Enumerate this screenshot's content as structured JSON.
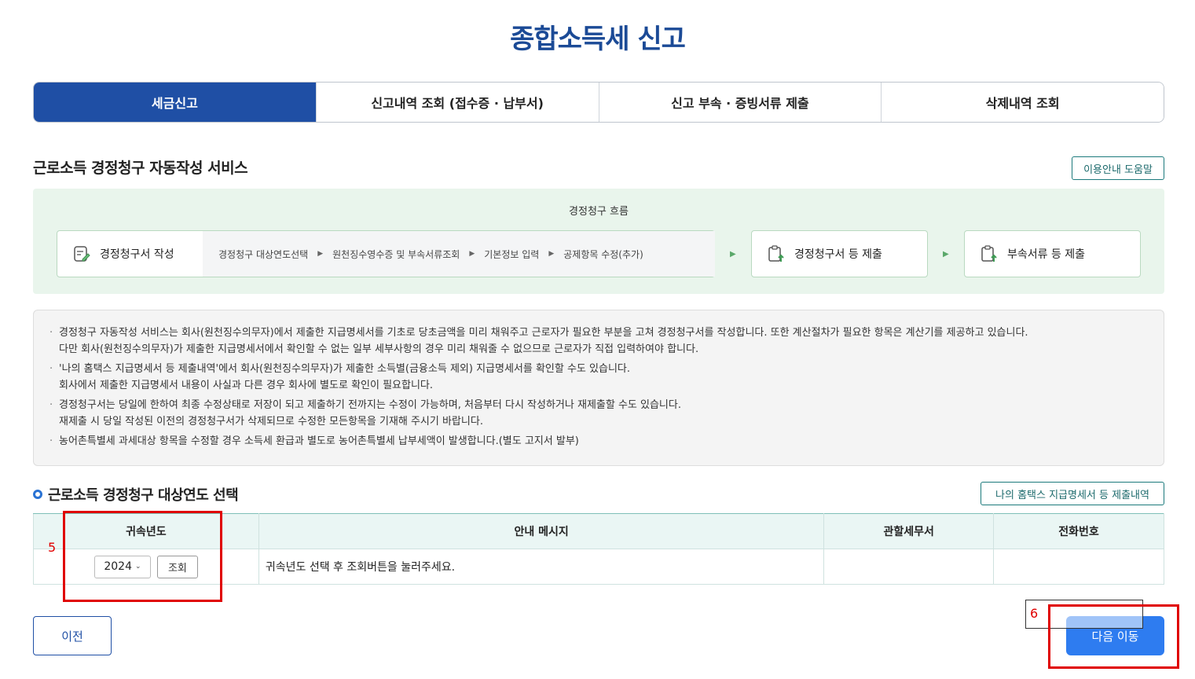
{
  "page": {
    "title": "종합소득세 신고"
  },
  "tabs": [
    {
      "label": "세금신고",
      "active": true
    },
    {
      "label": "신고내역 조회 (접수증 · 납부서)",
      "active": false
    },
    {
      "label": "신고 부속 · 증빙서류 제출",
      "active": false
    },
    {
      "label": "삭제내역 조회",
      "active": false
    }
  ],
  "service": {
    "title": "근로소득 경정청구 자동작성 서비스",
    "help_button": "이용안내 도움말"
  },
  "flow": {
    "title": "경정청구 흐름",
    "step1": {
      "label": "경정청구서 작성",
      "icon": "document-edit-icon"
    },
    "substeps": [
      "경정청구 대상연도선택",
      "원천징수영수증 및 부속서류조회",
      "기본정보 입력",
      "공제항목 수정(추가)"
    ],
    "step2": {
      "label": "경정청구서 등 제출",
      "icon": "document-upload-icon"
    },
    "step3": {
      "label": "부속서류 등 제출",
      "icon": "document-upload-icon"
    }
  },
  "notice": {
    "items": [
      [
        "경정청구 자동작성 서비스는 회사(원천징수의무자)에서 제출한 지급명세서를 기초로 당초금액을 미리 채워주고 근로자가 필요한 부분을 고쳐 경정청구서를 작성합니다. 또한 계산절차가 필요한 항목은 계산기를 제공하고 있습니다.",
        "다만 회사(원천징수의무자)가 제출한 지급명세서에서 확인할 수 없는 일부 세부사항의 경우 미리 채워줄 수 없으므로 근로자가 직접 입력하여야 합니다."
      ],
      [
        "'나의 홈택스 지급명세서 등 제출내역'에서 회사(원천징수의무자)가 제출한 소득별(금융소득 제외) 지급명세서를 확인할 수도 있습니다.",
        "회사에서 제출한 지급명세서 내용이 사실과 다른 경우 회사에 별도로 확인이 필요합니다."
      ],
      [
        "경정청구서는 당일에 한하여 최종 수정상태로 저장이 되고 제출하기 전까지는 수정이 가능하며, 처음부터 다시 작성하거나 재제출할 수도 있습니다.",
        "재제출 시 당일 작성된 이전의 경정청구서가 삭제되므로 수정한 모든항목을 기재해 주시기 바랍니다."
      ],
      [
        "농어촌특별세 과세대상 항목을 수정할 경우 소득세 환급과 별도로 농어촌특별세 납부세액이 발생합니다.(별도 고지서 발부)"
      ]
    ]
  },
  "year_section": {
    "title": "근로소득 경정청구 대상연도 선택",
    "hometax_button": "나의 홈택스 지급명세서 등 제출내역",
    "columns": [
      "귀속년도",
      "안내 메시지",
      "관할세무서",
      "전화번호"
    ],
    "row": {
      "year": "2024",
      "inquiry_button": "조회",
      "message": "귀속년도 선택 후 조회버튼을 눌러주세요.",
      "tax_office": "",
      "phone": ""
    }
  },
  "annotations": {
    "label_5": "5",
    "label_6": "6",
    "color": "#e00000"
  },
  "footer": {
    "prev_button": "이전",
    "next_button": "다음 이동"
  },
  "colors": {
    "brand": "#1f4fa5",
    "accent": "#2e7cf0",
    "teal": "#1c7a7c",
    "flow_bg": "#e9f5ec"
  }
}
